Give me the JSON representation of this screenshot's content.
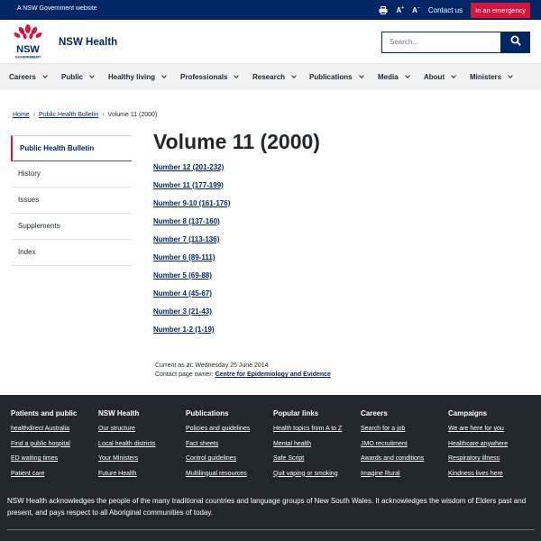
{
  "gov_bar": {
    "text": "A NSW Government website",
    "increase_text": "A",
    "decrease_text": "A",
    "contact": "Contact us",
    "emergency": "In an emergency"
  },
  "header": {
    "logo_text": "NSW",
    "logo_subtext": "GOVERNMENT",
    "site_title": "NSW Health",
    "search_placeholder": "Search..."
  },
  "nav": [
    {
      "label": "Careers"
    },
    {
      "label": "Public"
    },
    {
      "label": "Healthy living"
    },
    {
      "label": "Professionals"
    },
    {
      "label": "Research"
    },
    {
      "label": "Publications"
    },
    {
      "label": "Media"
    },
    {
      "label": "About"
    },
    {
      "label": "Ministers"
    }
  ],
  "breadcrumb": {
    "home": "Home",
    "parent": "Public Health Bulletin",
    "current": "Volume 11 (2000)"
  },
  "sidenav": [
    {
      "label": "Public Health Bulletin"
    },
    {
      "label": "History"
    },
    {
      "label": "Issues"
    },
    {
      "label": "Supplements"
    },
    {
      "label": "Index"
    }
  ],
  "main": {
    "title": "Volume 11 (2000)",
    "links": [
      "Number 12 (201-232)",
      "Number 11 (177-199)",
      "Number 9-10 (161-176)",
      "Number 8 (137-160)",
      "Number 7 (113-136)",
      "Number 6 (89-111)",
      "Number 5 (69-88)",
      "Number 4 (45-67)",
      "Number 3 (21-43)",
      "Number 1-2 (1-19)"
    ],
    "current_as_at": "Current as at: Wednesday 25 June 2014",
    "contact_owner_label": "Contact page owner:",
    "contact_owner": "Centre for Epidemiology and Evidence"
  },
  "footer": {
    "columns": [
      {
        "heading": "Patients and public",
        "links": [
          "healthdirect Australia",
          "Find a public hospital",
          "ED waiting times",
          "Patient care"
        ]
      },
      {
        "heading": "NSW Health",
        "links": [
          "Our structure",
          "Local health districts",
          "Your Ministers",
          "Future Health"
        ]
      },
      {
        "heading": "Publications",
        "links": [
          "Policies and guidelines",
          "Fact sheets",
          "Control guidelines",
          "Multilingual resources"
        ]
      },
      {
        "heading": "Popular links",
        "links": [
          "Health topics from A to Z",
          "Mental health",
          "Safe Script",
          "Quit vaping or smoking"
        ]
      },
      {
        "heading": "Careers",
        "links": [
          "Search for a job",
          "JMO recruitment",
          "Awards and conditions",
          "Imagine Rural"
        ]
      },
      {
        "heading": "Campaigns",
        "links": [
          "We are here for you",
          "Healthcare anywhere",
          "Respiratory illness",
          "Kindness lives here"
        ]
      }
    ],
    "acknowledgement": "NSW Health acknowledges the people of the many traditional countries and language groups of New South Wales. It acknowledges the wisdom of Elders past and present, and pays respect to all Aboriginal communities of today."
  },
  "colors": {
    "brand_navy": "#002664",
    "emergency_red": "#d7153a",
    "footer_bg": "#22272b"
  }
}
